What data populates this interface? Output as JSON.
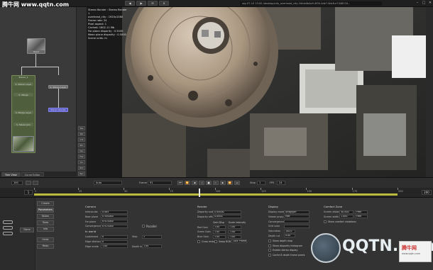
{
  "watermark": {
    "brand": "腾牛网 www.qqtn.com",
    "logo_text": "QQTN.com",
    "corner_title": "腾牛网",
    "corner_url": "www.qqtn.com"
  },
  "top_bar": {
    "buttons": [
      "◀",
      "▶",
      "⟳",
      "✕"
    ],
    "path": "sky-07-10 13:00 /desktop/city_overhead_city-16mb0b4a9-4f00-4de7-8dc6-e7448134...",
    "window_controls": [
      "–",
      "□",
      "✕"
    ]
  },
  "node_graph": {
    "tabs": [
      "Tree View",
      "Curve Editor"
    ],
    "nodes": [
      {
        "label": "Read",
        "kind": "read"
      },
      {
        "label": "Stereo_1",
        "kind": "group"
      },
      {
        "label": "S. Stereo Layer",
        "kind": "normal"
      },
      {
        "label": "S. Merge",
        "kind": "normal"
      },
      {
        "label": "S. Merge Layer",
        "kind": "normal"
      },
      {
        "label": "S. Stereo Join",
        "kind": "normal"
      },
      {
        "label": "Stereo Render",
        "kind": "selected"
      }
    ]
  },
  "side_buttons": [
    "Tex",
    "Nd",
    "Col",
    "Shr",
    "Vec",
    "Flw",
    "Uv",
    "Ent",
    "Spc",
    "Dep",
    "Pos"
  ],
  "viewer": {
    "info_lines": [
      "Stereo Render : Stereo Render 1",
      "overhead_city : 1920x1080",
      "Frame rate: 24",
      "Pixel aspect: 1",
      "Cached: 1802.11 Mb",
      "Far plane disparity : 0.5000",
      "Mean plane disparity : 0.5000",
      "Scene units: m"
    ]
  },
  "transport": {
    "zoom_field": "100",
    "view_select": "Auto",
    "frame_label": "Frame",
    "frame_value": "91",
    "step_label": "Step",
    "step_value": "1",
    "fps_label": "FPS",
    "fps_value": "24"
  },
  "timeline": {
    "start": "1",
    "end": "200",
    "ticks": [
      "1",
      "25",
      "50",
      "75",
      "100",
      "125",
      "150",
      "175",
      "200"
    ],
    "playhead_frame": 91
  },
  "properties": {
    "left_buttons": [
      "Done",
      "Show"
    ],
    "tabs": [
      "Create",
      "Parameters",
      "Notes",
      "Tools",
      "Info",
      "Undo",
      "Redo"
    ],
    "active_tab": "Parameters",
    "camera": {
      "title": "Camera",
      "rows": [
        {
          "label": "Interocular",
          "value": "0.065"
        },
        {
          "label": "Near plane",
          "value": "0.500000"
        },
        {
          "label": "Far plane",
          "value": "870.0000"
        },
        {
          "label": "Convergence",
          "value": "870.0000"
        }
      ],
      "parallel_label": "Parallel"
    },
    "in_world": {
      "title": "In world",
      "rows": [
        {
          "label": "Lookahead",
          "value": "0"
        },
        {
          "label": "Edge dilation",
          "value": "0"
        },
        {
          "label": "Edge erode",
          "value": "1.00"
        }
      ],
      "extra": [
        {
          "label": "Step",
          "value": "1"
        },
        {
          "label": "Depth in",
          "value": "1.00"
        }
      ]
    },
    "render": {
      "title": "Render",
      "rows": [
        {
          "label": "Disparity scale",
          "value": "0.00000"
        },
        {
          "label": "Disparity offset",
          "value": "0.0000"
        },
        {
          "label": "Red Gain",
          "value": "1.00"
        },
        {
          "label": "Green Gain",
          "value": "1.00"
        },
        {
          "label": "Blue Gain",
          "value": "1.00"
        }
      ],
      "gain_header": "Gain Disp",
      "scale_header": "Scale intensity",
      "gain_cols": [
        "1.00",
        "1.00",
        "1.00"
      ],
      "scale_cols": [
        "1.00",
        "1.00",
        "1.00"
      ],
      "cross_label": "Cross ends",
      "swap_label": "Swap RGB",
      "lock_label": "Lock Profile"
    },
    "display": {
      "title": "Display",
      "rows": [
        {
          "label": "Display mode",
          "value": "Anaglyph"
        },
        {
          "label": "Viewer proxy",
          "value": "Half"
        },
        {
          "label": "Convergence",
          "value": ""
        },
        {
          "label": "Grid color",
          "value": ""
        },
        {
          "label": "Saturation",
          "value": "100.0"
        }
      ],
      "checks": [
        "Show depth map",
        "Show disparity histogram",
        "Enable stereo display",
        "Cache 8 depth frame pixels"
      ],
      "depth_cut_label": "Depth cut",
      "depth_cut_value": "0.00"
    },
    "comfort": {
      "title": "Comfort Zone",
      "rows": [
        {
          "label": "Screen distance",
          "value": "40.000"
        },
        {
          "label": "Screen width",
          "value": "1.000"
        }
      ],
      "units": [
        "Feet",
        "Feet"
      ],
      "show_check": "Show comfort violations"
    }
  }
}
